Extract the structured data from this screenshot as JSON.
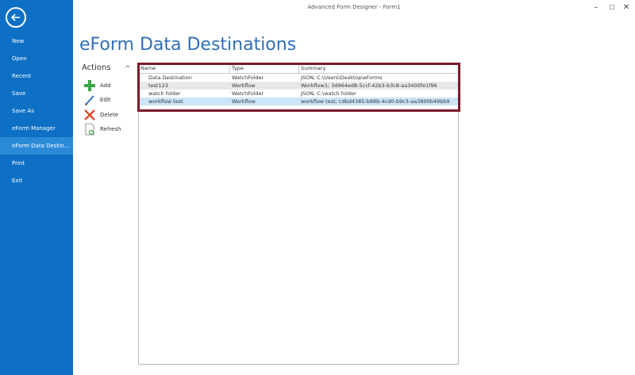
{
  "app": {
    "title": "Advanced Form Designer - Form1"
  },
  "window_controls": {
    "minimize": "–",
    "maximize": "☐",
    "close": "✕"
  },
  "sidebar": {
    "items": [
      {
        "label": "New"
      },
      {
        "label": "Open"
      },
      {
        "label": "Recent"
      },
      {
        "label": "Save"
      },
      {
        "label": "Save As"
      },
      {
        "label": "eForm Manager"
      },
      {
        "label": "eForm Data Destin..."
      },
      {
        "label": "Print"
      },
      {
        "label": "Exit"
      }
    ],
    "active_index": 6
  },
  "page": {
    "title": "eForm Data Destinations"
  },
  "actions": {
    "header": "Actions",
    "collapse_glyph": "^",
    "items": [
      {
        "label": "Add",
        "icon": "plus-icon"
      },
      {
        "label": "Edit",
        "icon": "pencil-icon"
      },
      {
        "label": "Delete",
        "icon": "x-icon"
      },
      {
        "label": "Refresh",
        "icon": "refresh-document-icon"
      }
    ]
  },
  "grid": {
    "columns": [
      "Name",
      "Type",
      "Summary"
    ],
    "rows": [
      {
        "name": "Data Destination",
        "type": "WatchFolder",
        "summary": "JSON;  C:\\Users\\Desktop\\eForms"
      },
      {
        "name": "test123",
        "type": "Workflow",
        "summary": "Workflow1;  3d964ed8-5ccf-42b3-b3c8-aa3400fe1f96"
      },
      {
        "name": "watch folder",
        "type": "WatchFolder",
        "summary": "JSON;  C:\\watch folder"
      },
      {
        "name": "workflow test",
        "type": "Workflow",
        "summary": "workflow test;  cdbd4385-b88b-4cd0-b9c3-aa3800b49bb9"
      }
    ],
    "selected_index": 3
  },
  "colors": {
    "sidebar_bg": "#0d70c5",
    "sidebar_active": "#2b8ad8",
    "title_blue": "#2f6fb8",
    "highlight_border": "#7a1a2a",
    "selected_row": "#cce4f7"
  }
}
